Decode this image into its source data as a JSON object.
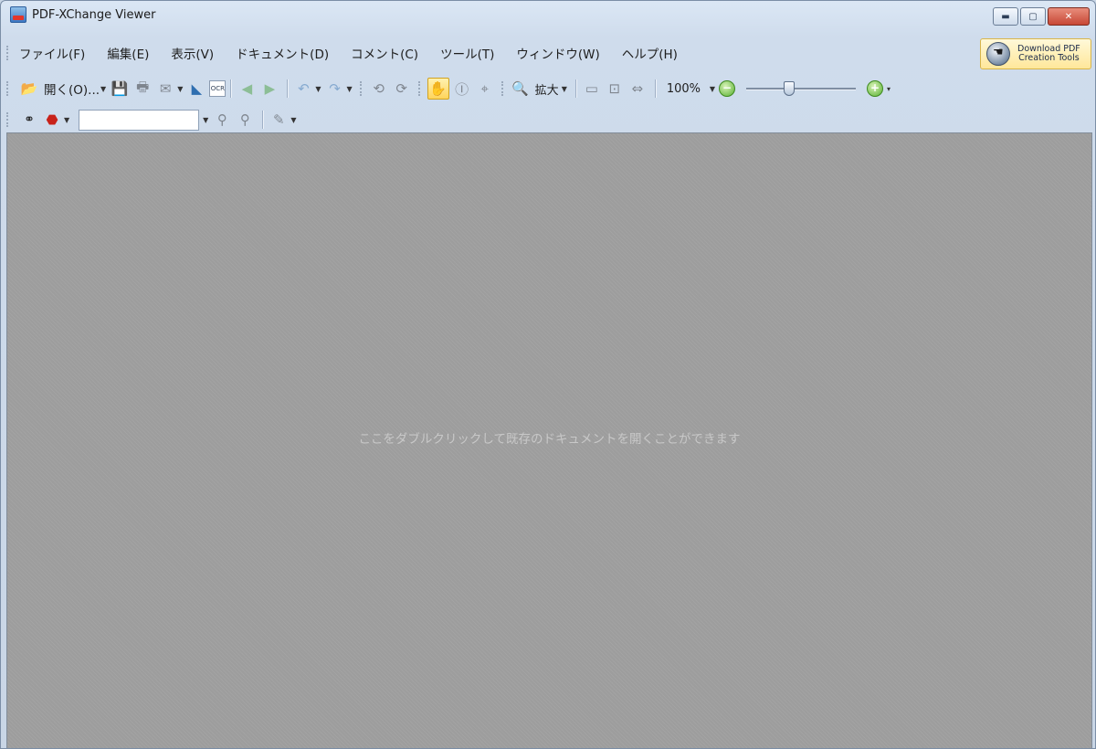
{
  "window": {
    "title": "PDF-XChange Viewer",
    "controls": {
      "minimize": "▬",
      "maximize": "▢",
      "close": "✕"
    }
  },
  "menubar": {
    "items": [
      "ファイル(F)",
      "編集(E)",
      "表示(V)",
      "ドキュメント(D)",
      "コメント(C)",
      "ツール(T)",
      "ウィンドウ(W)",
      "ヘルプ(H)"
    ],
    "download_line1": "Download PDF",
    "download_line2": "Creation Tools"
  },
  "toolbar1": {
    "open_label": "開く(O)...",
    "zoom_label": "拡大",
    "zoom_value": "100%",
    "zoom_slider_fraction": 0.38,
    "icons": [
      "folder-open-icon",
      "save-icon",
      "print-icon",
      "email-icon",
      "scan-icon",
      "ocr-icon",
      "back-icon",
      "forward-icon",
      "undo-icon",
      "redo-icon",
      "rotate-left-icon",
      "rotate-right-icon",
      "hand-tool-icon",
      "select-text-icon",
      "snapshot-icon",
      "zoom-icon",
      "actual-size-icon",
      "fit-page-icon",
      "fit-width-icon",
      "zoom-out-icon",
      "zoom-in-icon"
    ]
  },
  "toolbar2": {
    "search_value": "",
    "icons": [
      "binoculars-icon",
      "acrobat-search-icon",
      "find-prev-icon",
      "find-next-icon",
      "highlight-icon"
    ]
  },
  "document": {
    "hint": "ここをダブルクリックして既存のドキュメントを開くことができます",
    "background": "#9d9d9d"
  },
  "colors": {
    "chrome": "#c9d6e6",
    "active_tool": "#ffd45a",
    "close_button": "#c74735"
  }
}
